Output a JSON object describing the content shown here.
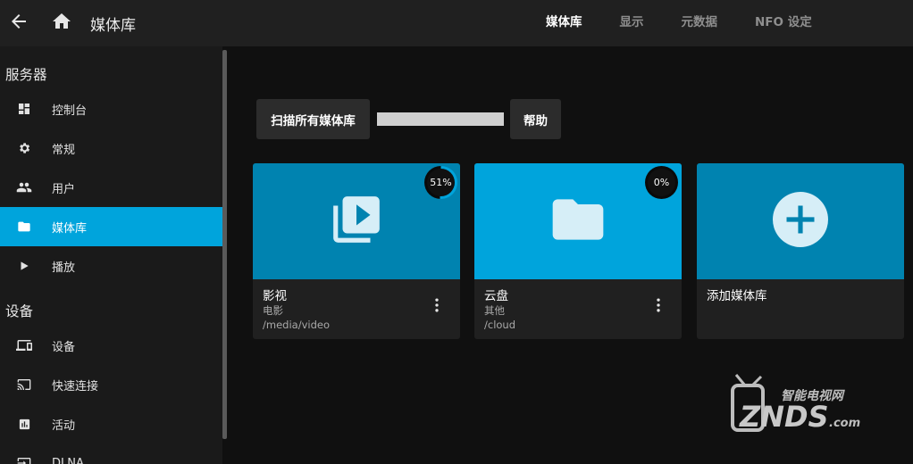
{
  "header": {
    "title": "媒体库",
    "tabs": [
      {
        "label": "媒体库",
        "active": true
      },
      {
        "label": "显示",
        "active": false
      },
      {
        "label": "元数据",
        "active": false
      },
      {
        "label": "NFO 设定",
        "active": false
      }
    ]
  },
  "sidebar": {
    "section_server": "服务器",
    "section_devices": "设备",
    "items": [
      {
        "label": "控制台",
        "icon": "dashboard-icon"
      },
      {
        "label": "常规",
        "icon": "gear-icon"
      },
      {
        "label": "用户",
        "icon": "users-icon"
      },
      {
        "label": "媒体库",
        "icon": "folder-icon",
        "active": true
      },
      {
        "label": "播放",
        "icon": "play-icon"
      },
      {
        "label": "设备",
        "icon": "devices-icon"
      },
      {
        "label": "快速连接",
        "icon": "cast-icon"
      },
      {
        "label": "活动",
        "icon": "activity-icon"
      },
      {
        "label": "DLNA",
        "icon": "dlna-icon"
      }
    ]
  },
  "toolbar": {
    "scan_label": "扫描所有媒体库",
    "help_label": "帮助"
  },
  "libraries": [
    {
      "name": "影视",
      "type": "电影",
      "path": "/media/video",
      "progress_label": "51%",
      "progress": 51,
      "icon": "video-library-icon"
    },
    {
      "name": "云盘",
      "type": "其他",
      "path": "/cloud",
      "progress_label": "0%",
      "progress": 0,
      "icon": "folder-icon"
    }
  ],
  "add_library": {
    "label": "添加媒体库",
    "icon": "add-icon"
  },
  "watermark": {
    "text_top": "智能电视网",
    "text_main": "ZNDS",
    "text_domain": ".com"
  },
  "colors": {
    "accent": "#00a4dc",
    "card_blue_dark": "#0083b0",
    "card_blue": "#00a4dc"
  }
}
